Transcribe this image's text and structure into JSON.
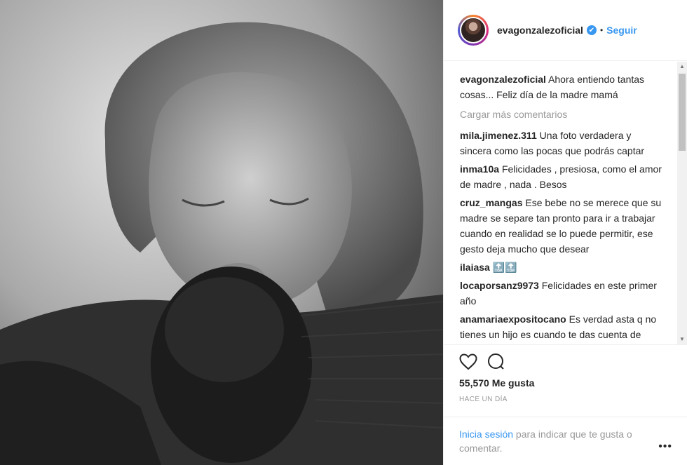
{
  "header": {
    "username": "evagonzalezoficial",
    "verified_mark": "✔",
    "separator": "•",
    "follow_label": "Seguir"
  },
  "comments": [
    {
      "user": "evagonzalezoficial",
      "text": "Ahora entiendo tantas cosas... Feliz día de la madre mamá"
    },
    {
      "user": "mila.jimenez.311",
      "text": "Una foto verdadera y sincera como las pocas que podrás captar"
    },
    {
      "user": "inma10a",
      "text": "Felicidades , presiosa, como el amor de madre , nada . Besos"
    },
    {
      "user": "cruz_mangas",
      "text": "Ese bebe no se merece que su madre se separe tan pronto para ir a trabajar cuando en realidad se lo puede permitir, ese gesto deja mucho que desear"
    },
    {
      "user": "ilaiasa",
      "text": "🔝🔝"
    },
    {
      "user": "locaporsanz9973",
      "text": "Felicidades en este primer año"
    },
    {
      "user": "anamariaexpositocano",
      "text": "Es verdad asta q no tienes un hijo es cuando te das cuenta de cuánto te quieren 😮😮😮♥♥♥"
    }
  ],
  "load_more_label": "Cargar más comentarios",
  "likes_label": "55,570 Me gusta",
  "time_label": "HACE UN DÍA",
  "login": {
    "link": "Inicia sesión",
    "rest": " para indicar que te gusta o comentar."
  },
  "more_label": "•••",
  "icons": {
    "like": "heart-icon",
    "comment": "comment-icon",
    "verified": "verified-badge-icon"
  }
}
